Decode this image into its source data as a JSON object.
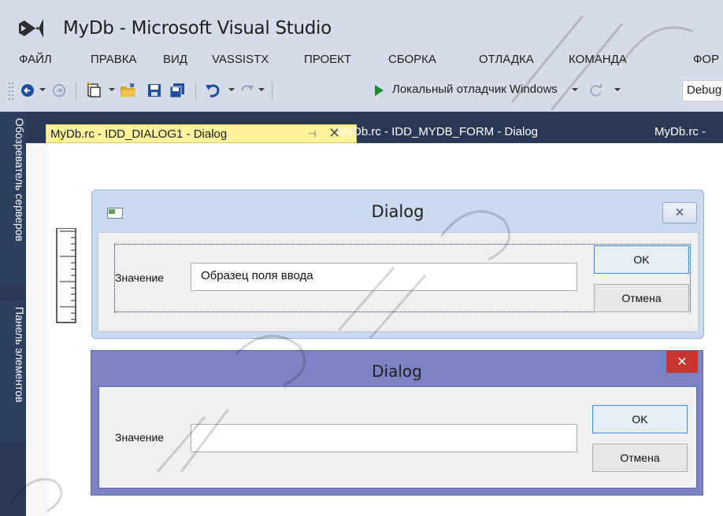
{
  "window": {
    "title": "MyDb - Microsoft Visual Studio"
  },
  "menu": {
    "items": [
      {
        "label": "ФАЙЛ"
      },
      {
        "label": "ПРАВКА"
      },
      {
        "label": "ВИД"
      },
      {
        "label": "VASSISTX"
      },
      {
        "label": "ПРОЕКТ"
      },
      {
        "label": "СБОРКА"
      },
      {
        "label": "ОТЛАДКА"
      },
      {
        "label": "КОМАНДА"
      },
      {
        "label": "ФОР"
      }
    ]
  },
  "toolbar": {
    "debugger_label": "Локальный отладчик Windows",
    "configuration": "Debug",
    "icons": [
      "back-icon",
      "forward-icon",
      "new-project-icon",
      "open-file-icon",
      "save-icon",
      "save-all-icon",
      "undo-icon",
      "redo-icon",
      "start-debugging-icon",
      "refresh-icon"
    ]
  },
  "sidebar": {
    "tabs": [
      {
        "label": "Обозреватель серверов"
      },
      {
        "label": "Панель элементов"
      }
    ]
  },
  "tabs": [
    {
      "label": "MyDb.rc - IDD_DIALOG1 - Dialog",
      "active": true
    },
    {
      "label": "MyDb.rc - IDD_MYDB_FORM - Dialog",
      "active": false
    },
    {
      "label": "MyDb.rc -",
      "active": false
    }
  ],
  "design_dialog": {
    "title": "Dialog",
    "close_label": "✕",
    "value_label": "Значение",
    "input_value": "Образец поля ввода",
    "ok_label": "OK",
    "cancel_label": "Отмена"
  },
  "runtime_dialog": {
    "title": "Dialog",
    "close_label": "✕",
    "value_label": "Значение",
    "input_value": "",
    "ok_label": "OK",
    "cancel_label": "Отмена"
  },
  "colors": {
    "chrome": "#d6dbe9",
    "panel": "#293955",
    "active_tab": "#fff29d",
    "runtime_frame": "#7b83c5",
    "close_red": "#c7362e"
  }
}
